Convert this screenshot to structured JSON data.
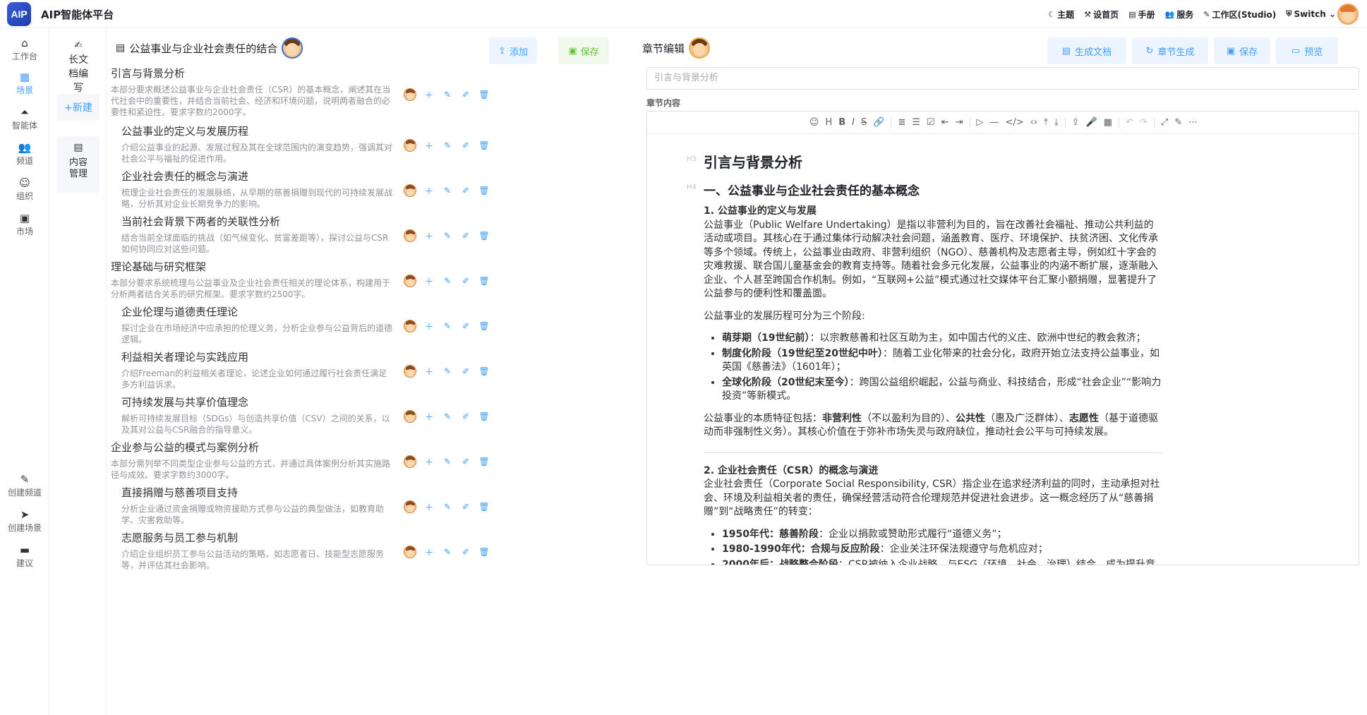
{
  "app": {
    "logo": "AIP",
    "title": "AIP智能体平台"
  },
  "topnav": [
    {
      "icon": "☾",
      "label": "主题"
    },
    {
      "icon": "⚒",
      "label": "设首页"
    },
    {
      "icon": "▤",
      "label": "手册"
    },
    {
      "icon": "👥",
      "label": "服务"
    },
    {
      "icon": "✎",
      "label": "工作区(Studio)"
    },
    {
      "icon": "⛨",
      "label": "Switch ⌄"
    }
  ],
  "rail": [
    {
      "icon": "⌂",
      "label": "工作台"
    },
    {
      "icon": "▦",
      "label": "场景"
    },
    {
      "icon": "⏶",
      "label": "智能体"
    },
    {
      "icon": "👥",
      "label": "频道"
    },
    {
      "icon": "☺",
      "label": "组织"
    },
    {
      "icon": "▣",
      "label": "市场"
    },
    {
      "icon": "✎",
      "label": "创建频道"
    },
    {
      "icon": "➤",
      "label": "创建场景"
    },
    {
      "icon": "▬",
      "label": "建议"
    }
  ],
  "sub": {
    "long_doc": "长文档编写",
    "new": "+新建",
    "content_mgmt": "内容管理"
  },
  "left": {
    "title": "公益事业与企业社会责任的结合",
    "add": "添加",
    "save": "保存"
  },
  "outline": [
    {
      "level": 1,
      "title": "引言与背景分析",
      "desc": "本部分要求概述公益事业与企业社会责任（CSR）的基本概念，阐述其在当代社会中的重要性，并结合当前社会、经济和环境问题，说明两者融合的必要性和紧迫性。要求字数约2000字。"
    },
    {
      "level": 2,
      "title": "公益事业的定义与发展历程",
      "desc": "介绍公益事业的起源、发展过程及其在全球范围内的演变趋势，强调其对社会公平与福祉的促进作用。"
    },
    {
      "level": 2,
      "title": "企业社会责任的概念与演进",
      "desc": "梳理企业社会责任的发展脉络，从早期的慈善捐赠到现代的可持续发展战略，分析其对企业长期竞争力的影响。"
    },
    {
      "level": 2,
      "title": "当前社会背景下两者的关联性分析",
      "desc": "结合当前全球面临的挑战（如气候变化、贫富差距等），探讨公益与CSR如何协同应对这些问题。"
    },
    {
      "level": 1,
      "title": "理论基础与研究框架",
      "desc": "本部分要求系统梳理与公益事业及企业社会责任相关的理论体系，构建用于分析两者结合关系的研究框架。要求字数约2500字。"
    },
    {
      "level": 2,
      "title": "企业伦理与道德责任理论",
      "desc": "探讨企业在市场经济中应承担的伦理义务，分析企业参与公益背后的道德逻辑。"
    },
    {
      "level": 2,
      "title": "利益相关者理论与实践应用",
      "desc": "介绍Freeman的利益相关者理论，论述企业如何通过履行社会责任满足多方利益诉求。"
    },
    {
      "level": 2,
      "title": "可持续发展与共享价值理念",
      "desc": "解析可持续发展目标（SDGs）与创造共享价值（CSV）之间的关系，以及其对公益与CSR融合的指导意义。"
    },
    {
      "level": 1,
      "title": "企业参与公益的模式与案例分析",
      "desc": "本部分需列举不同类型企业参与公益的方式，并通过具体案例分析其实施路径与成效。要求字数约3000字。"
    },
    {
      "level": 2,
      "title": "直接捐赠与慈善项目支持",
      "desc": "分析企业通过资金捐赠或物资援助方式参与公益的典型做法，如教育助学、灾害救助等。"
    },
    {
      "level": 2,
      "title": "志愿服务与员工参与机制",
      "desc": "介绍企业组织员工参与公益活动的策略，如志愿者日、技能型志愿服务等，并评估其社会影响。"
    }
  ],
  "right": {
    "title": "章节编辑",
    "btn_gen_doc": "生成文档",
    "btn_chapter_gen": "章节生成",
    "btn_save": "保存",
    "btn_preview": "预览",
    "section_placeholder": "引言与背景分析",
    "content_label": "章节内容"
  },
  "editor": {
    "toolbar": [
      "☺",
      "H",
      "B",
      "I",
      "S",
      "🔗",
      "|",
      "≣",
      "☰",
      "☑",
      "⇤",
      "⇥",
      "|",
      "▷",
      "—",
      "</>",
      "‹›",
      "⤒",
      "⤓",
      "|",
      "⇪",
      "🎤",
      "▦",
      "|",
      "↶",
      "↷",
      "|",
      "⤢",
      "✎",
      "⋯"
    ],
    "h3_mark": "H3",
    "h4_mark": "H4",
    "h3": "引言与背景分析",
    "h4": "一、公益事业与企业社会责任的基本概念",
    "s1_title": "1. 公益事业的定义与发展",
    "s1_p1": "公益事业（Public Welfare Undertaking）是指以非营利为目的，旨在改善社会福祉、推动公共利益的活动或项目。其核心在于通过集体行动解决社会问题，涵盖教育、医疗、环境保护、扶贫济困、文化传承等多个领域。传统上，公益事业由政府、非营利组织（NGO）、慈善机构及志愿者主导，例如红十字会的灾难救援、联合国儿童基金会的教育支持等。随着社会多元化发展，公益事业的内涵不断扩展，逐渐融入企业、个人甚至跨国合作机制。例如，“互联网+公益”模式通过社交媒体平台汇聚小额捐赠，显著提升了公益参与的便利性和覆盖面。",
    "s1_p2": "公益事业的发展历程可分为三个阶段:",
    "s1_li1_b": "萌芽期（19世纪前）",
    "s1_li1": "：以宗教慈善和社区互助为主，如中国古代的义庄、欧洲中世纪的教会救济；",
    "s1_li2_b": "制度化阶段（19世纪至20世纪中叶）",
    "s1_li2": "：随着工业化带来的社会分化，政府开始立法支持公益事业，如英国《慈善法》（1601年）；",
    "s1_li3_b": "全球化阶段（20世纪末至今）",
    "s1_li3": "：跨国公益组织崛起，公益与商业、科技结合，形成“社会企业”“影响力投资”等新模式。",
    "s1_p3_a": "公益事业的本质特征包括：",
    "s1_p3_b1": "非营利性",
    "s1_p3_c": "（不以盈利为目的）、",
    "s1_p3_b2": "公共性",
    "s1_p3_d": "（惠及广泛群体）、",
    "s1_p3_b3": "志愿性",
    "s1_p3_e": "（基于道德驱动而非强制性义务）。其核心价值在于弥补市场失灵与政府缺位，推动社会公平与可持续发展。",
    "s2_title": "2. 企业社会责任（CSR）的概念与演进",
    "s2_p1": "企业社会责任（Corporate Social Responsibility, CSR）指企业在追求经济利益的同时，主动承担对社会、环境及利益相关者的责任，确保经营活动符合伦理规范并促进社会进步。这一概念经历了从“慈善捐赠”到“战略责任”的转变：",
    "s2_li1_b": "1950年代：慈善阶段",
    "s2_li1": "：企业以捐款或赞助形式履行“道德义务”；",
    "s2_li2_b": "1980-1990年代：合规与反应阶段",
    "s2_li2": "：企业关注环保法规遵守与危机应对；",
    "s2_li3_b": "2000年后：战略整合阶段",
    "s2_li3": "：CSR被纳入企业战略，与ESG（环境、社会、治理）结合，成为提升竞争力的关键要素。"
  }
}
